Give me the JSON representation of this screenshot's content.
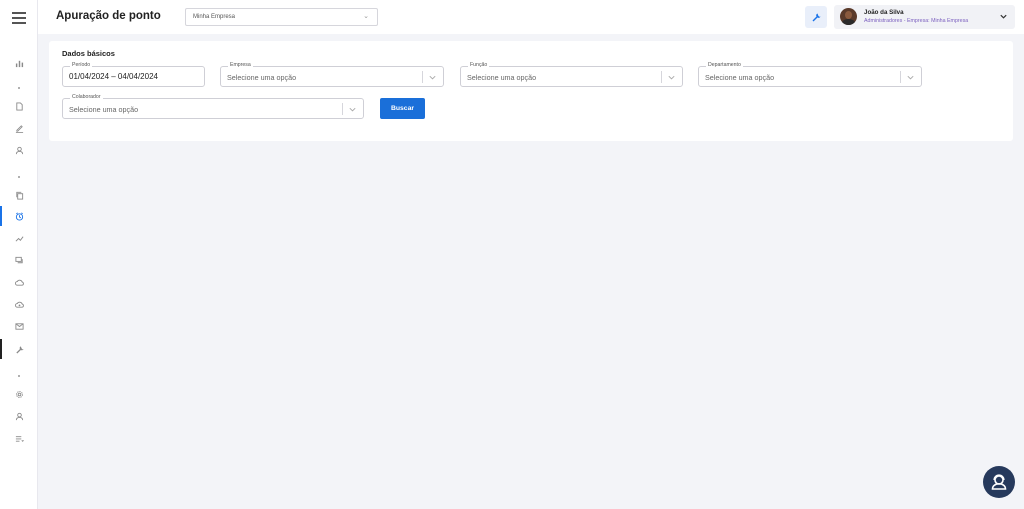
{
  "header": {
    "title": "Apuração de ponto",
    "company_select": {
      "value": "Minha Empresa"
    },
    "user": {
      "name": "João da Silva",
      "role": "Administradores - Empresa: Minha Empresa"
    }
  },
  "filters": {
    "section_title": "Dados básicos",
    "periodo": {
      "label": "Período",
      "value": "01/04/2024 – 04/04/2024"
    },
    "empresa": {
      "label": "Empresa",
      "placeholder": "Selecione uma opção"
    },
    "funcao": {
      "label": "Função",
      "placeholder": "Selecione uma opção"
    },
    "departamento": {
      "label": "Departamento",
      "placeholder": "Selecione uma opção"
    },
    "colaborador": {
      "label": "Colaborador",
      "placeholder": "Selecione uma opção"
    },
    "search_button": "Buscar"
  },
  "sidebar": {
    "icons": [
      "menu-icon",
      "bar-chart-icon",
      "document-icon",
      "edit-icon",
      "user-icon",
      "copy-icon",
      "clock-icon",
      "trend-icon",
      "chat-icon",
      "cloud-upload-icon",
      "cloud-download-icon",
      "mail-icon",
      "wrench-icon",
      "gear-icon",
      "user-icon",
      "list-icon"
    ]
  },
  "colors": {
    "accent": "#1a6fd9",
    "fab": "#26395c",
    "role_text": "#7b5fbf"
  }
}
